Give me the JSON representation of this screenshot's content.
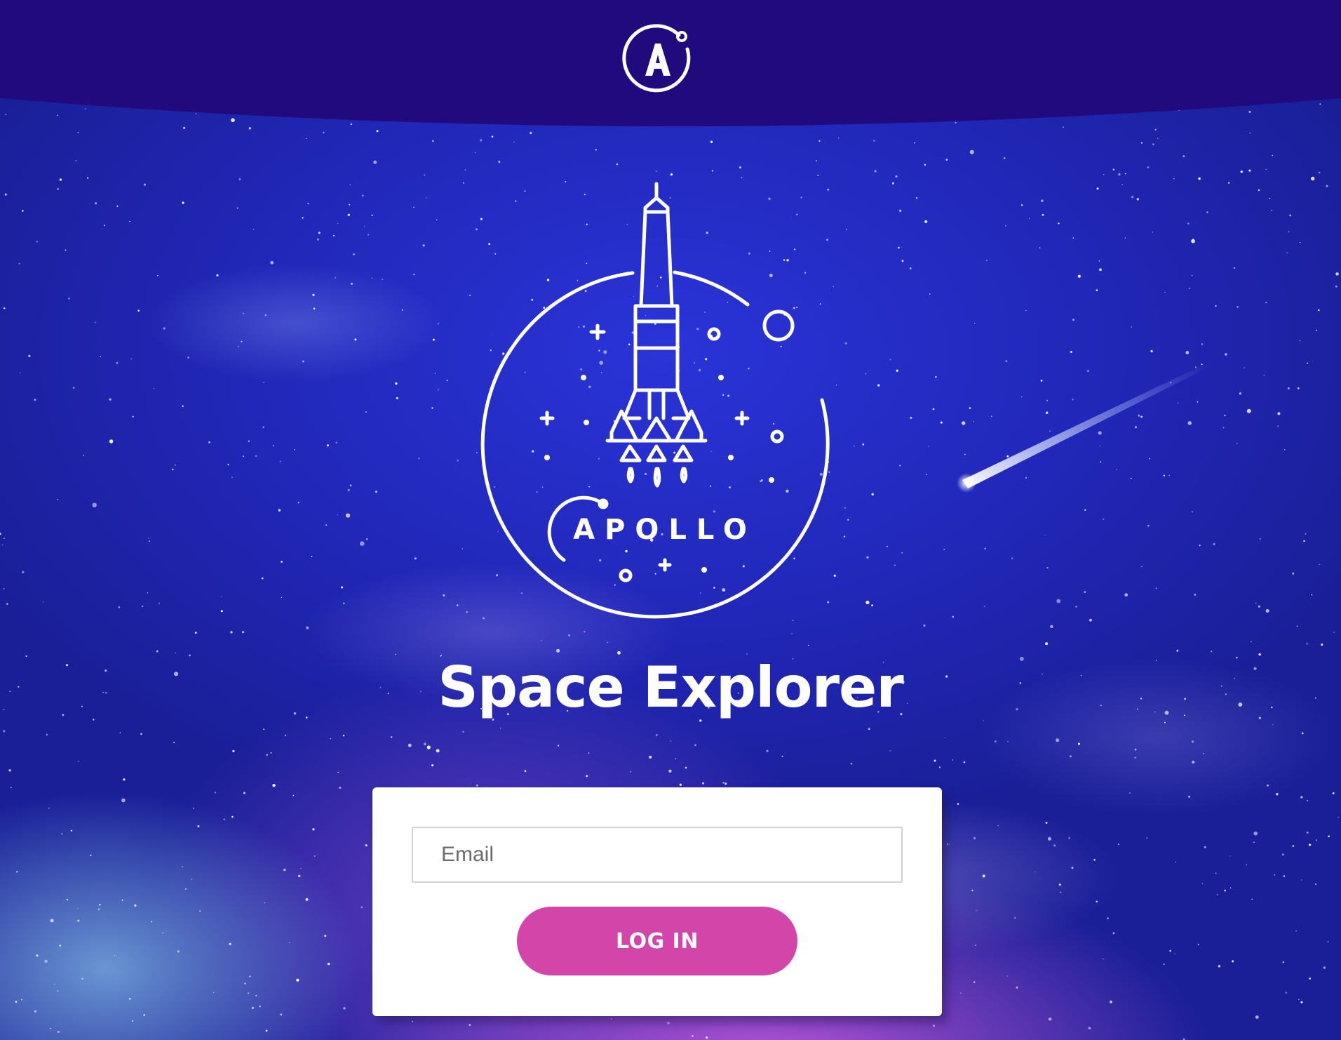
{
  "header": {
    "logo_icon": "apollo-a-icon",
    "background_color": "#200a7e"
  },
  "hero": {
    "logo_icon": "apollo-rocket-emblem-icon",
    "logo_text": "APOLLO",
    "title": "Space Explorer"
  },
  "login_form": {
    "email_placeholder": "Email",
    "email_value": "",
    "submit_label": "LOG IN",
    "button_color": "#d345a8"
  },
  "decoration": {
    "comet_icon": "shooting-star-icon"
  }
}
